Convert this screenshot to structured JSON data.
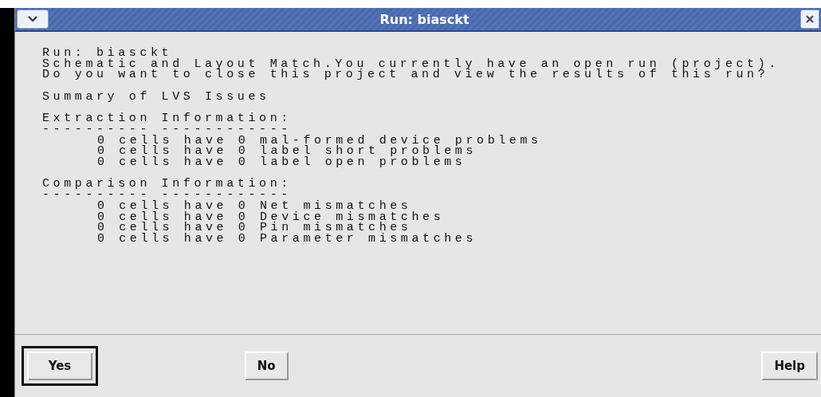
{
  "window": {
    "title": "Run: biasckt"
  },
  "intro": [
    "Run: biasckt",
    "Schematic and Layout Match.You currently have an open run (project).",
    "Do you want to close this project and view the results of this run?"
  ],
  "summary": "Summary of LVS Issues",
  "sections": [
    {
      "heading": "Extraction Information:",
      "rule": "---------- ------------",
      "items": [
        "0 cells have 0 mal-formed device problems",
        "0 cells have 0 label short problems",
        "0 cells have 0 label open problems"
      ]
    },
    {
      "heading": "Comparison Information:",
      "rule": "---------- ------------",
      "items": [
        "0 cells have 0 Net mismatches",
        "0 cells have 0 Device mismatches",
        "0 cells have 0 Pin mismatches",
        "0 cells have 0 Parameter mismatches"
      ]
    }
  ],
  "buttons": [
    {
      "label": "Yes",
      "focused": true
    },
    {
      "label": "No",
      "focused": false
    },
    {
      "label": "Help",
      "focused": false
    }
  ]
}
